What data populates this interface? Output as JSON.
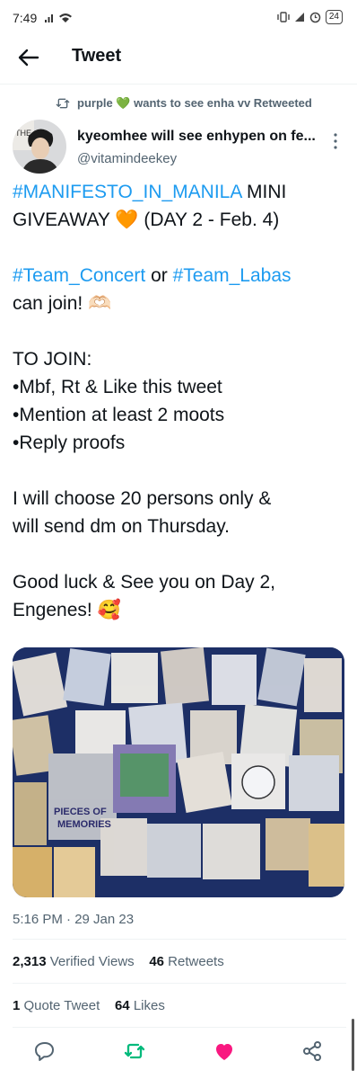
{
  "status_bar": {
    "time": "7:49",
    "battery": "24"
  },
  "header": {
    "title": "Tweet"
  },
  "retweet_context": {
    "text": "purple 💚 wants to see enha vv Retweeted"
  },
  "author": {
    "display_name": "kyeomhee will see enhypen on fe...",
    "handle": "@vitamindeekey"
  },
  "tweet": {
    "line1_hashtag": "#MANIFESTO_IN_MANILA",
    "line1_rest": " MINI",
    "line2": "GIVEAWAY 🧡 (DAY 2 - Feb. 4)",
    "line3_tag1": "#Team_Concert",
    "line3_mid": " or ",
    "line3_tag2": "#Team_Labas",
    "line4": "can join! 🫶🏻",
    "line5": "TO JOIN:",
    "line6": "•Mbf, Rt & Like this tweet",
    "line7": "•Mention at least 2 moots",
    "line8": "•Reply proofs",
    "line9": "I will choose 20 persons only &",
    "line10": "will send dm on Thursday.",
    "line11": "Good luck & See you on Day 2,",
    "line12": "Engenes! 🥰"
  },
  "media": {
    "book_title_line1": "PIECES OF",
    "book_title_line2": "MEMORIES"
  },
  "timestamp": "5:16 PM · 29 Jan 23",
  "stats": {
    "views_count": "2,313",
    "views_label": " Verified Views",
    "retweets_count": "46",
    "retweets_label": " Retweets",
    "quotes_count": "1",
    "quotes_label": " Quote Tweet",
    "likes_count": "64",
    "likes_label": " Likes"
  },
  "colors": {
    "link": "#1d9bf0",
    "retweet_green": "#00ba7c",
    "like_pink": "#f91880",
    "muted": "#536471"
  },
  "icons": [
    "back-arrow-icon",
    "retweet-icon",
    "more-icon",
    "reply-icon",
    "retweet-icon",
    "heart-icon",
    "share-icon"
  ]
}
